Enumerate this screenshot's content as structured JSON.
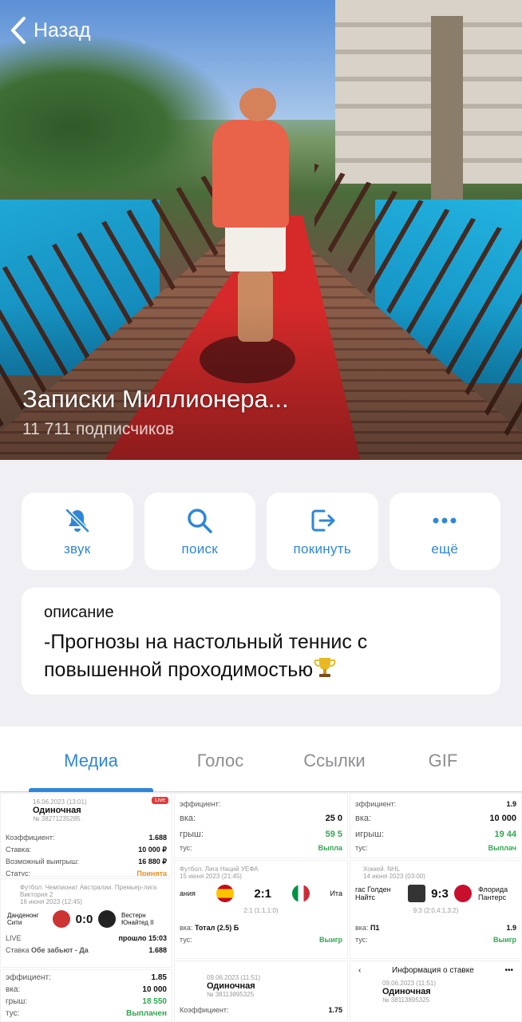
{
  "header": {
    "back_label": "Назад",
    "channel_title": "Записки Миллионера...",
    "subscribers": "11 711 подписчиков"
  },
  "actions": [
    {
      "label": "звук",
      "icon": "bell-mute-icon"
    },
    {
      "label": "поиск",
      "icon": "search-icon"
    },
    {
      "label": "покинуть",
      "icon": "leave-icon"
    },
    {
      "label": "ещё",
      "icon": "more-icon"
    }
  ],
  "description": {
    "label": "описание",
    "text": "-Прогнозы на настольный теннис с повышенной проходимостью"
  },
  "tabs": [
    {
      "label": "Медиа",
      "active": true
    },
    {
      "label": "Голос",
      "active": false
    },
    {
      "label": "Ссылки",
      "active": false
    },
    {
      "label": "GIF",
      "active": false
    }
  ],
  "media": {
    "c1": {
      "date": "16.06.2023 (13:01)",
      "type": "Одиночная",
      "num": "№ 38271235285",
      "live": "Live",
      "rows": [
        [
          "Коэффициент:",
          "1.688"
        ],
        [
          "Ставка:",
          "10 000 ₽"
        ],
        [
          "Возможный выигрыш:",
          "16 880 ₽"
        ],
        [
          "Статус:",
          "Принята"
        ]
      ]
    },
    "c2": {
      "rows": [
        [
          "эффициент:",
          ""
        ],
        [
          "вка:",
          "25 0"
        ],
        [
          "грыш:",
          "59 5"
        ],
        [
          "тус:",
          "Выпла"
        ]
      ]
    },
    "c3": {
      "rows": [
        [
          "эффициент:",
          "1.9"
        ],
        [
          "вка:",
          "10 000"
        ],
        [
          "игрыш:",
          "19 44"
        ],
        [
          "тус:",
          "Выплач"
        ]
      ]
    },
    "c4": {
      "league": "Футбол. Чемпионат Австралии. Премьер-лига Виктория 2",
      "date": "16 июня 2023 (12:45)",
      "team1": "Данденонг Сити",
      "team2": "Вестерн Юнайтед II",
      "score": "0:0",
      "live_label": "LIVE",
      "elapsed": "прошло 15:03",
      "bet": "Обе забьют - Да",
      "coef": "1.688",
      "bet_label": "Ставка"
    },
    "c5": {
      "league": "Футбол. Лига Наций УЕФА",
      "date": "15 июня 2023 (21:45)",
      "team_left": "ания",
      "score": "2:1",
      "team_right": "Ита",
      "sub": "2:1 (1:1,1:0)",
      "bet": "Тотал (2.5) Б",
      "status_label": "тус:",
      "status": "Выигр",
      "bet_label": "вка:"
    },
    "c6": {
      "league": "Хоккей. NHL",
      "date": "14 июня 2023 (03:00)",
      "team_left": "гас Голден Найтс",
      "score": "9:3",
      "team_right": "Флорида Пантерс",
      "sub": "9:3 (2:0,4:1,3:2)",
      "bet": "П1",
      "coef": "1.9",
      "status_label": "тус:",
      "status": "Выигр",
      "bet_label": "вка:"
    },
    "c7": {
      "rows": [
        [
          "эффициент:",
          "1.85"
        ],
        [
          "вка:",
          "10 000"
        ],
        [
          "грыш:",
          "18 550"
        ],
        [
          "тус:",
          "Выплачен"
        ]
      ]
    },
    "c8": {
      "date": "09.06.2023 (11:51)",
      "type": "Одиночная",
      "num": "№ 38113895325",
      "coef_label": "Коэффициент:",
      "coef": "1.75"
    },
    "c9": {
      "title": "Информация о ставке",
      "date": "09.06.2023 (11:51)",
      "type": "Одиночная",
      "num": "№ 38113895325"
    }
  }
}
